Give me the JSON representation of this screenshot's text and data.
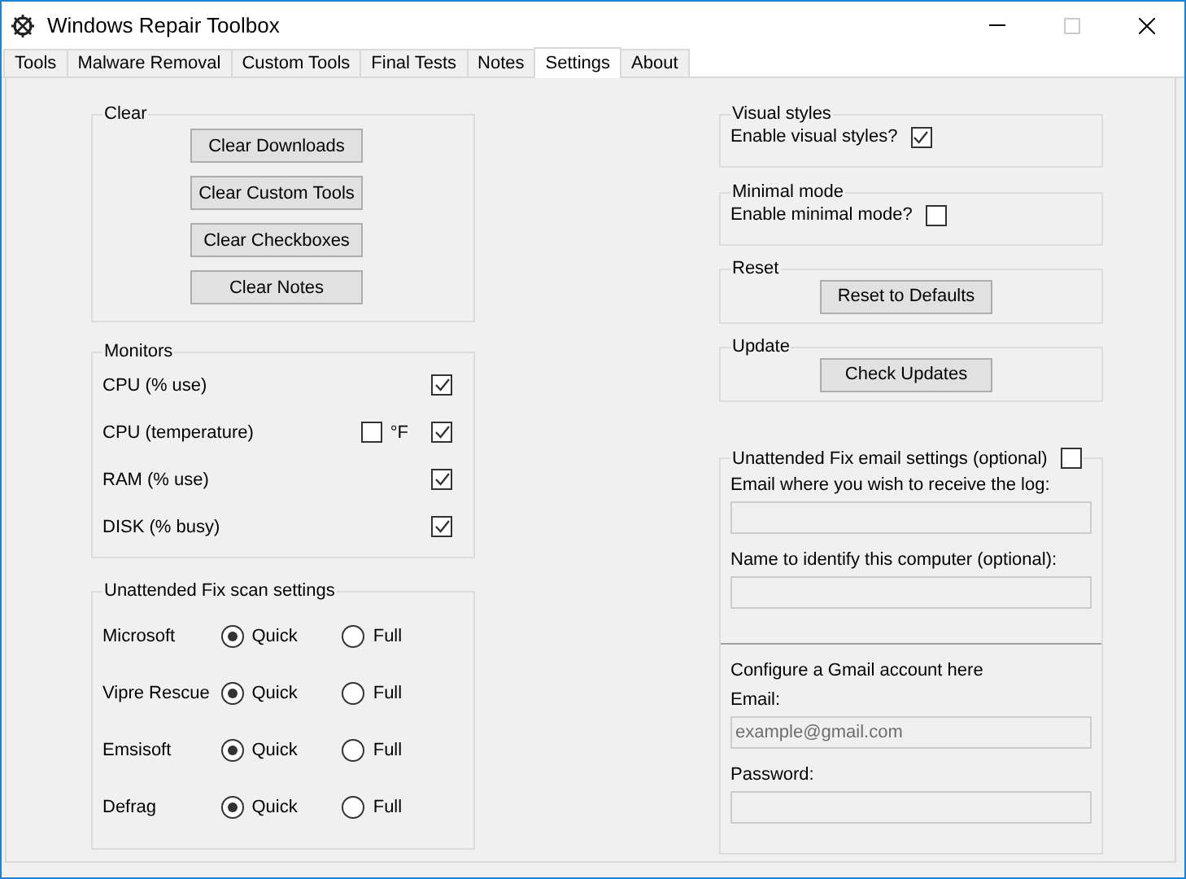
{
  "window": {
    "title": "Windows Repair Toolbox"
  },
  "tabs": [
    {
      "label": "Tools",
      "selected": false
    },
    {
      "label": "Malware Removal",
      "selected": false
    },
    {
      "label": "Custom Tools",
      "selected": false
    },
    {
      "label": "Final Tests",
      "selected": false
    },
    {
      "label": "Notes",
      "selected": false
    },
    {
      "label": "Settings",
      "selected": true
    },
    {
      "label": "About",
      "selected": false
    }
  ],
  "clear_group": {
    "title": "Clear",
    "buttons": [
      "Clear Downloads",
      "Clear Custom Tools",
      "Clear Checkboxes",
      "Clear Notes"
    ]
  },
  "monitors": {
    "title": "Monitors",
    "items": [
      {
        "label": "CPU (% use)",
        "checked": true
      },
      {
        "label": "CPU (temperature)",
        "checked": true,
        "unit": {
          "label": "°F",
          "checked": false
        }
      },
      {
        "label": "RAM (% use)",
        "checked": true
      },
      {
        "label": "DISK (% busy)",
        "checked": true
      }
    ]
  },
  "scan_settings": {
    "title": "Unattended Fix scan settings",
    "rows": [
      {
        "name": "Microsoft",
        "options": [
          {
            "label": "Quick",
            "selected": true
          },
          {
            "label": "Full",
            "selected": false
          }
        ]
      },
      {
        "name": "Vipre Rescue",
        "options": [
          {
            "label": "Quick",
            "selected": true
          },
          {
            "label": "Full",
            "selected": false
          }
        ]
      },
      {
        "name": "Emsisoft",
        "options": [
          {
            "label": "Quick",
            "selected": true
          },
          {
            "label": "Full",
            "selected": false
          }
        ]
      },
      {
        "name": "Defrag",
        "options": [
          {
            "label": "Quick",
            "selected": true
          },
          {
            "label": "Full",
            "selected": false
          }
        ]
      }
    ]
  },
  "visual_styles": {
    "title": "Visual styles",
    "label": "Enable visual styles?",
    "checked": true
  },
  "minimal_mode": {
    "title": "Minimal mode",
    "label": "Enable minimal mode?",
    "checked": false
  },
  "reset": {
    "title": "Reset",
    "button": "Reset to Defaults"
  },
  "update": {
    "title": "Update",
    "button": "Check Updates"
  },
  "email_settings": {
    "title": "Unattended Fix email settings (optional)",
    "checked": false,
    "fields": [
      {
        "label": "Email where you wish to receive the log:",
        "disabled": true
      },
      {
        "label": "Name to identify this computer (optional):",
        "disabled": true
      }
    ],
    "gmail": {
      "heading": "Configure a Gmail account here",
      "fields": [
        {
          "label": "Email:",
          "placeholder": "example@gmail.com",
          "disabled": true
        },
        {
          "label": "Password:",
          "disabled": true
        }
      ]
    }
  }
}
